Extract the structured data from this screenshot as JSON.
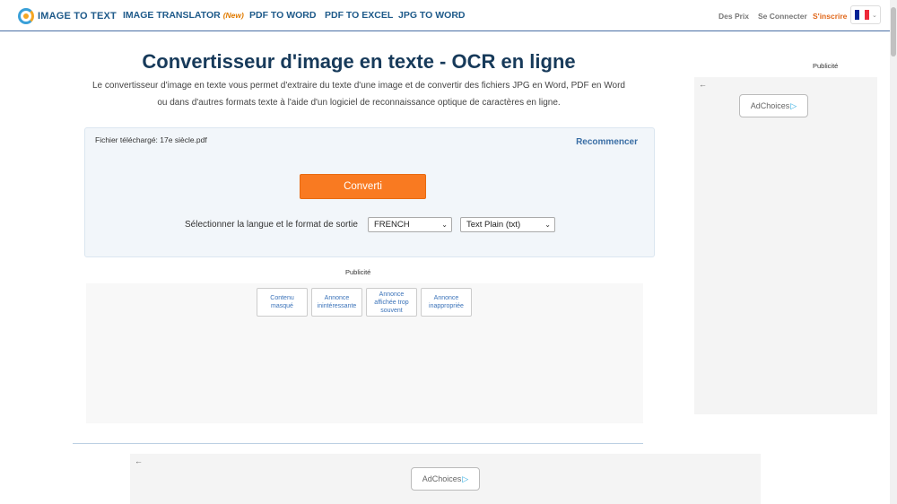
{
  "header": {
    "logo": "IMAGE TO TEXT",
    "nav": [
      {
        "label": "IMAGE TRANSLATOR",
        "badge": "(New)"
      },
      {
        "label": "PDF TO WORD"
      },
      {
        "label": "PDF TO EXCEL"
      },
      {
        "label": "JPG TO WORD"
      }
    ],
    "pricing": "Des Prix",
    "login": "Se Connecter",
    "signup": "S'inscrire",
    "flag_colors": [
      "#002395",
      "#ffffff",
      "#ed2939"
    ]
  },
  "main": {
    "title": "Convertisseur d'image en texte - OCR en ligne",
    "subtitle_line1": "Le convertisseur d'image en texte vous permet d'extraire du texte d'une image et de convertir des fichiers JPG en Word, PDF en Word",
    "subtitle_line2": "ou dans d'autres formats texte à l'aide d'un logiciel de reconnaissance optique de caractères en ligne.",
    "file_label": "Fichier téléchargé:",
    "file_name": "17e siècle.pdf",
    "restart": "Recommencer",
    "convert_button": "Converti",
    "lang_label": "Sélectionner la langue et le format de sortie",
    "language": "FRENCH",
    "format": "Text Plain (txt)"
  },
  "ads": {
    "publicite": "Publicité",
    "options": [
      "Contenu masqué",
      "Annonce inintéressante",
      "Annonce affichée trop souvent",
      "Annonce inappropriée"
    ],
    "adchoices": "AdChoices",
    "back": "←"
  }
}
